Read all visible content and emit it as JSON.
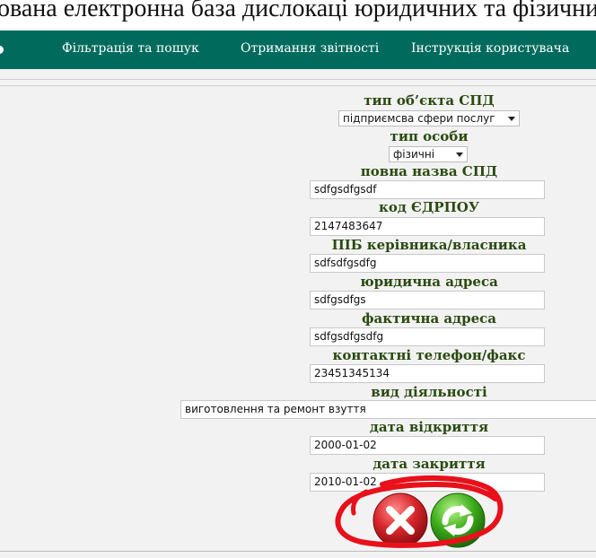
{
  "header": {
    "title": "ована електронна база дислокаці юридичних та фізичних о"
  },
  "nav": {
    "items": [
      {
        "label": "Фільтрація та пошук"
      },
      {
        "label": "Отримання звітності"
      },
      {
        "label": "Інструкція користувача"
      }
    ]
  },
  "form": {
    "object_type": {
      "label": "тип об’єкта СПД",
      "value": "підприємсва сфери послуг"
    },
    "person_type": {
      "label": "тип особи",
      "value": "фізичні"
    },
    "full_name": {
      "label": "повна назва СПД",
      "value": "sdfgsdfgsdf"
    },
    "edrpou": {
      "label": "код ЄДРПОУ",
      "value": "2147483647"
    },
    "manager": {
      "label": "ПІБ керівника/власника",
      "value": "sdfsdfgsdfg"
    },
    "legal_address": {
      "label": "юридична адреса",
      "value": "sdfgsdfgs"
    },
    "actual_address": {
      "label": "фактична адреса",
      "value": "sdfgsdfgsdfg"
    },
    "phone": {
      "label": "контактні телефон/факс",
      "value": "23451345134"
    },
    "activity": {
      "label": "вид діяльності",
      "value": "виготовлення та ремонт взуття"
    },
    "open_date": {
      "label": "дата відкриття",
      "value": "2000-01-02"
    },
    "close_date": {
      "label": "дата закриття",
      "value": "2010-01-02"
    }
  },
  "actions": {
    "cancel_icon": "x-icon",
    "refresh_icon": "refresh-icon",
    "cancel_color": "#d8262b",
    "refresh_color": "#3fae1c",
    "annotation_color": "#e8101a"
  }
}
